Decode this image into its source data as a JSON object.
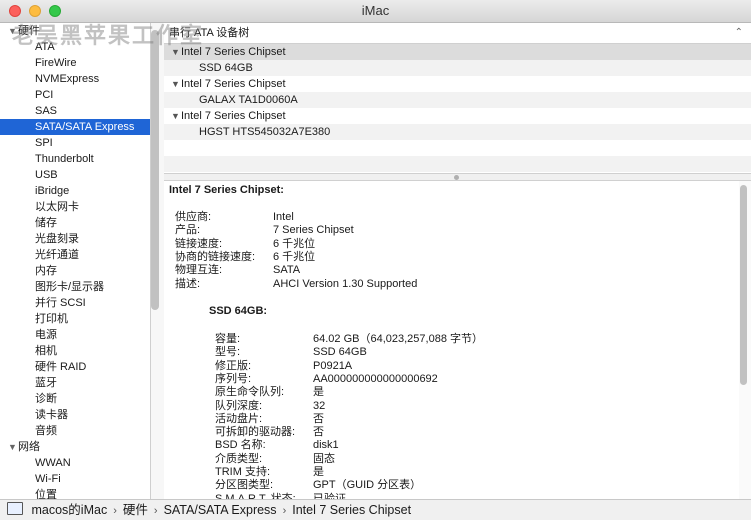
{
  "window": {
    "title": "iMac"
  },
  "watermark": "老吴黑苹果工作室",
  "sidebar": {
    "groups": [
      {
        "label": "硬件",
        "items": [
          "ATA",
          "FireWire",
          "NVMExpress",
          "PCI",
          "SAS",
          "SATA/SATA Express",
          "SPI",
          "Thunderbolt",
          "USB",
          "iBridge",
          "以太网卡",
          "储存",
          "光盘刻录",
          "光纤通道",
          "内存",
          "图形卡/显示器",
          "并行 SCSI",
          "打印机",
          "电源",
          "相机",
          "硬件 RAID",
          "蓝牙",
          "诊断",
          "读卡器",
          "音频"
        ]
      },
      {
        "label": "网络",
        "items": [
          "WWAN",
          "Wi-Fi",
          "位置"
        ]
      }
    ],
    "selected": "SATA/SATA Express"
  },
  "device_list": {
    "header": "串行 ATA 设备树",
    "rows": [
      {
        "kind": "controller",
        "label": "Intel 7 Series Chipset"
      },
      {
        "kind": "device",
        "label": "SSD 64GB"
      },
      {
        "kind": "controller",
        "label": "Intel 7 Series Chipset"
      },
      {
        "kind": "device",
        "label": "GALAX TA1D0060A"
      },
      {
        "kind": "controller",
        "label": "Intel 7 Series Chipset"
      },
      {
        "kind": "device",
        "label": "HGST HTS545032A7E380"
      }
    ]
  },
  "detail": {
    "title": "Intel 7 Series Chipset:",
    "controller_props": [
      {
        "k": "供应商:",
        "v": "Intel"
      },
      {
        "k": "产品:",
        "v": "7 Series Chipset"
      },
      {
        "k": "链接速度:",
        "v": "6 千兆位"
      },
      {
        "k": "协商的链接速度:",
        "v": "6 千兆位"
      },
      {
        "k": "物理互连:",
        "v": "SATA"
      },
      {
        "k": "描述:",
        "v": "AHCI Version 1.30 Supported"
      }
    ],
    "device_title": "SSD 64GB:",
    "device_props": [
      {
        "k": "容量:",
        "v": "64.02 GB（64,023,257,088 字节）"
      },
      {
        "k": "型号:",
        "v": "SSD 64GB"
      },
      {
        "k": "修正版:",
        "v": "P0921A"
      },
      {
        "k": "序列号:",
        "v": "AA000000000000000692"
      },
      {
        "k": "原生命令队列:",
        "v": "是"
      },
      {
        "k": "队列深度:",
        "v": "32"
      },
      {
        "k": "活动盘片:",
        "v": "否"
      },
      {
        "k": "可拆卸的驱动器:",
        "v": "否"
      },
      {
        "k": "BSD 名称:",
        "v": "disk1"
      },
      {
        "k": "介质类型:",
        "v": "固态"
      },
      {
        "k": "TRIM 支持:",
        "v": "是"
      },
      {
        "k": "分区图类型:",
        "v": "GPT（GUID 分区表）"
      },
      {
        "k": "S.M.A.R.T. 状态:",
        "v": "已验证"
      }
    ]
  },
  "breadcrumb": [
    "macos的iMac",
    "硬件",
    "SATA/SATA Express",
    "Intel 7 Series Chipset"
  ]
}
